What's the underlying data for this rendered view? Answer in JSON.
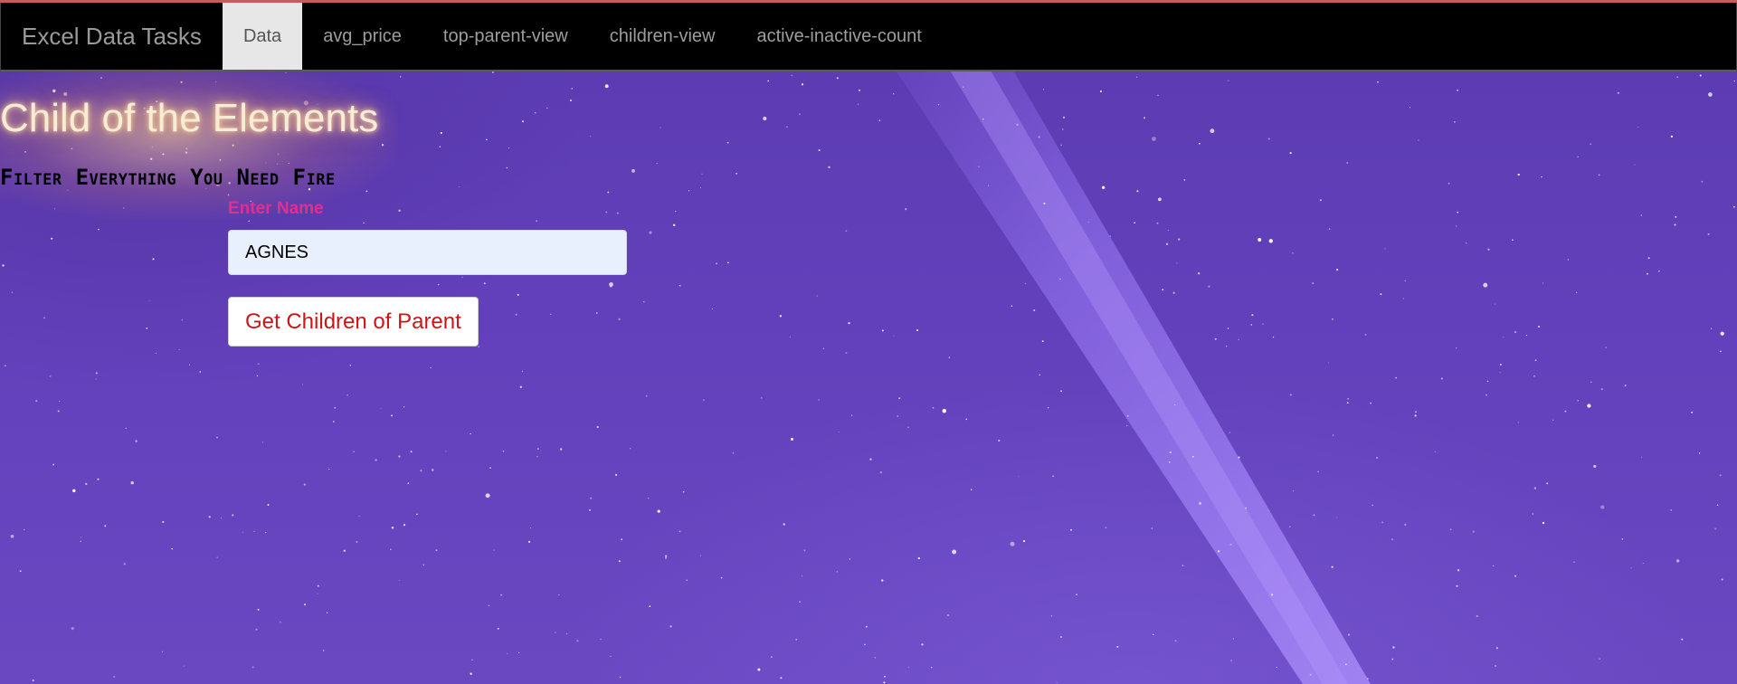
{
  "navbar": {
    "brand": "Excel Data Tasks",
    "items": [
      {
        "label": "Data",
        "active": true
      },
      {
        "label": "avg_price",
        "active": false
      },
      {
        "label": "top-parent-view",
        "active": false
      },
      {
        "label": "children-view",
        "active": false
      },
      {
        "label": "active-inactive-count",
        "active": false
      }
    ]
  },
  "hero": {
    "title": "Child of the Elements",
    "tagline": "Filter Everything You Need Fire"
  },
  "form": {
    "name_label": "Enter Name",
    "name_value": "AGNES",
    "submit_label": "Get Children of Parent"
  },
  "colors": {
    "navbar_bg": "#000000",
    "active_tab_bg": "#e7e7e7",
    "label_color": "#e0308f",
    "button_text": "#cc1616",
    "background": "#6240bb"
  }
}
